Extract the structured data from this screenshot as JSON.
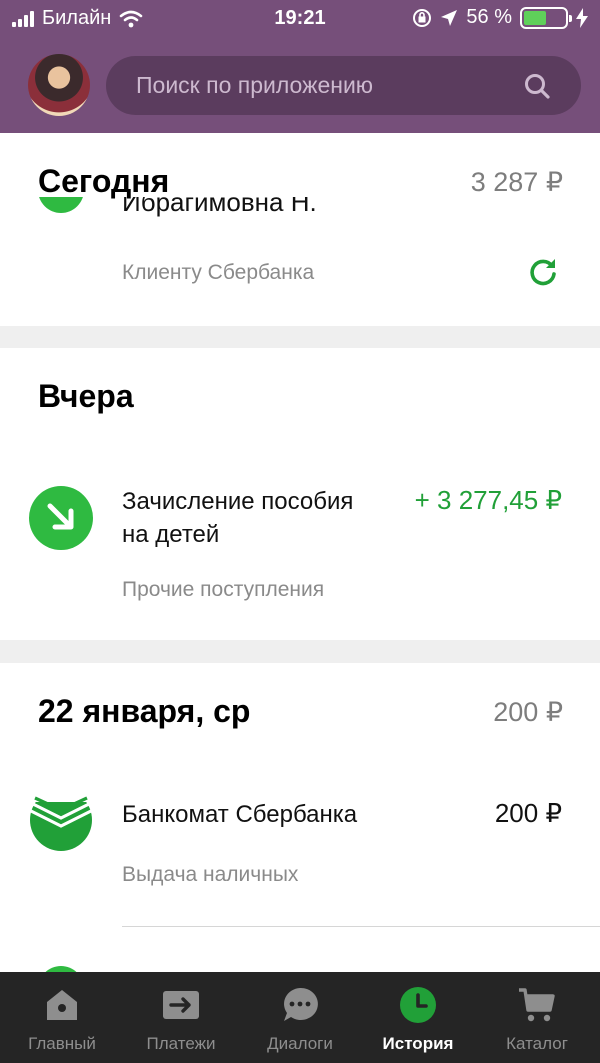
{
  "status_bar": {
    "carrier": "Билайн",
    "time": "19:21",
    "battery_percent": "56 %",
    "battery_level": 0.56,
    "battery_color": "#5fd05a"
  },
  "header": {
    "background_color": "#764f7a",
    "search_placeholder": "Поиск по приложению"
  },
  "sections": [
    {
      "title": "Сегодня",
      "total": "3 287 ₽",
      "transactions": [
        {
          "title_partial": "Ибрагимовна Н.",
          "subtitle": "Клиенту Сбербанка",
          "icon": "repeat-icon"
        }
      ]
    },
    {
      "title": "Вчера",
      "transactions": [
        {
          "title_line1": "Зачисление пособия",
          "title_line2": "на детей",
          "subtitle": "Прочие поступления",
          "amount": "+ 3 277,45 ₽",
          "icon": "incoming-arrow-icon"
        }
      ]
    },
    {
      "title": "22 января, ср",
      "total": "200 ₽",
      "transactions": [
        {
          "title": "Банкомат Сбербанка",
          "subtitle": "Выдача наличных",
          "amount": "200 ₽",
          "icon": "sberbank-logo-icon"
        }
      ]
    }
  ],
  "tabs": [
    {
      "label": "Главный",
      "icon": "home-icon",
      "active": false
    },
    {
      "label": "Платежи",
      "icon": "payments-arrow-icon",
      "active": false
    },
    {
      "label": "Диалоги",
      "icon": "chat-icon",
      "active": false
    },
    {
      "label": "История",
      "icon": "clock-icon",
      "active": true
    },
    {
      "label": "Каталог",
      "icon": "cart-icon",
      "active": false
    }
  ],
  "colors": {
    "accent_green": "#21a038",
    "tabbar": "#252525"
  }
}
